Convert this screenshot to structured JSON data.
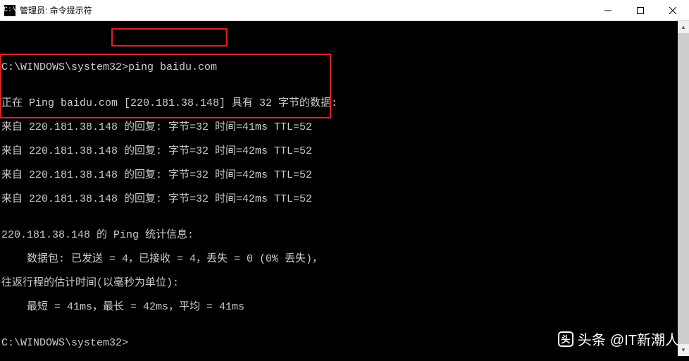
{
  "titlebar": {
    "icon_label": "C:\\",
    "title": "管理员: 命令提示符"
  },
  "terminal": {
    "prompt1_path": "C:\\WINDOWS\\system32>",
    "command": "ping baidu.com",
    "blank1": "",
    "ping_header": "正在 Ping baidu.com [220.181.38.148] 具有 32 字节的数据:",
    "reply1": "来自 220.181.38.148 的回复: 字节=32 时间=41ms TTL=52",
    "reply2": "来自 220.181.38.148 的回复: 字节=32 时间=42ms TTL=52",
    "reply3": "来自 220.181.38.148 的回复: 字节=32 时间=42ms TTL=52",
    "reply4": "来自 220.181.38.148 的回复: 字节=32 时间=42ms TTL=52",
    "blank2": "",
    "stats_header": "220.181.38.148 的 Ping 统计信息:",
    "stats_packets": "    数据包: 已发送 = 4，已接收 = 4，丢失 = 0 (0% 丢失)，",
    "stats_rtt_header": "往返行程的估计时间(以毫秒为单位):",
    "stats_rtt": "    最短 = 41ms，最长 = 42ms，平均 = 41ms",
    "blank3": "",
    "prompt2": "C:\\WINDOWS\\system32>"
  },
  "watermark": {
    "icon_text": "头",
    "label": "头条",
    "handle": "@IT新潮人"
  }
}
